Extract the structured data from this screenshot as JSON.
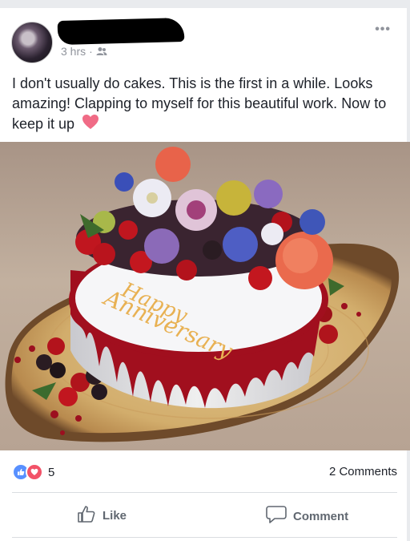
{
  "post": {
    "timestamp": "3 hrs",
    "audience_icon": "friends-icon",
    "menu_glyph": "•••",
    "text": "I don't usually do cakes. This is the first in a while. Looks amazing! Clapping to myself for this beautiful work. Now to keep it up",
    "cake_inscription_line1": "Happy",
    "cake_inscription_line2": "Anniversary"
  },
  "engagement": {
    "reaction_count": "5",
    "comments_label": "2 Comments"
  },
  "actions": {
    "like_label": "Like",
    "comment_label": "Comment"
  },
  "colors": {
    "accent_blue": "#5890ff",
    "love_red": "#f25268",
    "meta_gray": "#90949c"
  }
}
